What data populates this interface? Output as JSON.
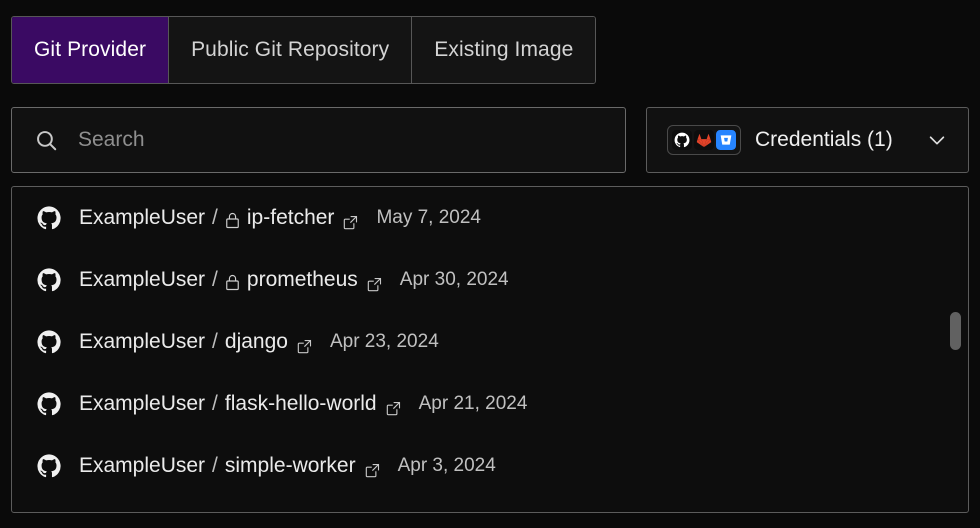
{
  "tabs": [
    {
      "label": "Git Provider",
      "active": true
    },
    {
      "label": "Public Git Repository",
      "active": false
    },
    {
      "label": "Existing Image",
      "active": false
    }
  ],
  "search": {
    "placeholder": "Search",
    "value": "",
    "icon": "search-icon"
  },
  "credentials": {
    "label": "Credentials (1)",
    "count": 1,
    "provider_icons": [
      "github-icon",
      "gitlab-icon",
      "bitbucket-icon"
    ],
    "chevron": "chevron-down-icon"
  },
  "colors": {
    "page_background": "#0a0a0a",
    "active_tab_background": "#3a0a63",
    "panel_border": "#5c5c5c",
    "text_primary": "#ebebeb",
    "text_muted": "#8f8f8f",
    "gitlab_orange": "#e24329",
    "bitbucket_blue": "#2684ff",
    "scrollbar_thumb": "#616161"
  },
  "repositories": [
    {
      "provider_icon": "github-icon",
      "owner": "ExampleUser",
      "separator": "/",
      "private": true,
      "name": "ip-fetcher",
      "external_link_icon": "external-link-icon",
      "date": "May 7, 2024"
    },
    {
      "provider_icon": "github-icon",
      "owner": "ExampleUser",
      "separator": "/",
      "private": true,
      "name": "prometheus",
      "external_link_icon": "external-link-icon",
      "date": "Apr 30, 2024"
    },
    {
      "provider_icon": "github-icon",
      "owner": "ExampleUser",
      "separator": "/",
      "private": false,
      "name": "django",
      "external_link_icon": "external-link-icon",
      "date": "Apr 23, 2024"
    },
    {
      "provider_icon": "github-icon",
      "owner": "ExampleUser",
      "separator": "/",
      "private": false,
      "name": "flask-hello-world",
      "external_link_icon": "external-link-icon",
      "date": "Apr 21, 2024"
    },
    {
      "provider_icon": "github-icon",
      "owner": "ExampleUser",
      "separator": "/",
      "private": false,
      "name": "simple-worker",
      "external_link_icon": "external-link-icon",
      "date": "Apr 3, 2024"
    }
  ],
  "scrollbar": {
    "name": "repo-list-scrollbar"
  }
}
